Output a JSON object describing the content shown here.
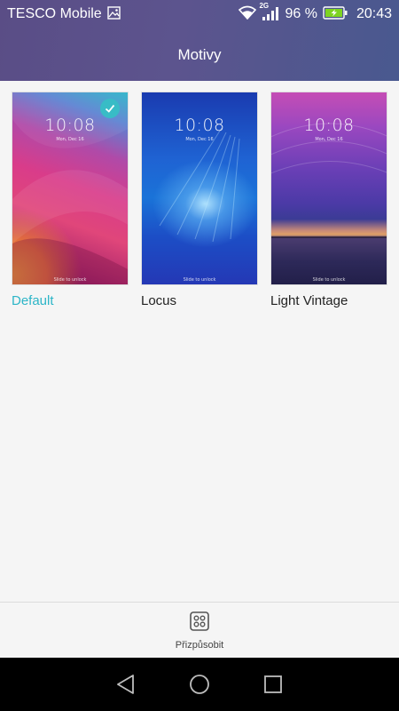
{
  "status_bar": {
    "carrier": "TESCO Mobile",
    "network_type": "2G",
    "battery_percent": "96 %",
    "time": "20:43",
    "icons": [
      "image-notification-icon",
      "wifi-icon",
      "signal-icon",
      "battery-charging-icon"
    ]
  },
  "title_bar": {
    "title": "Motivy"
  },
  "themes": [
    {
      "name": "Default",
      "selected": true,
      "preview": {
        "time": "10:08",
        "date": "Mon, Dec 16",
        "unlock_text": "Slide to unlock"
      }
    },
    {
      "name": "Locus",
      "selected": false,
      "preview": {
        "time": "10:08",
        "date": "Mon, Dec 16",
        "unlock_text": "Slide to unlock"
      }
    },
    {
      "name": "Light Vintage",
      "selected": false,
      "preview": {
        "time": "10:08",
        "date": "Mon, Dec 16",
        "unlock_text": "Slide to unlock"
      }
    }
  ],
  "action_bar": {
    "customize_label": "Přizpůsobit",
    "customize_icon": "customize-grid-icon"
  },
  "nav_bar": {
    "icons": [
      "back-icon",
      "home-icon",
      "recents-icon"
    ]
  },
  "colors": {
    "accent": "#2cb5c7",
    "check_badge": "#38bcc6",
    "header_start": "#5a4d86",
    "header_end": "#49598f"
  }
}
